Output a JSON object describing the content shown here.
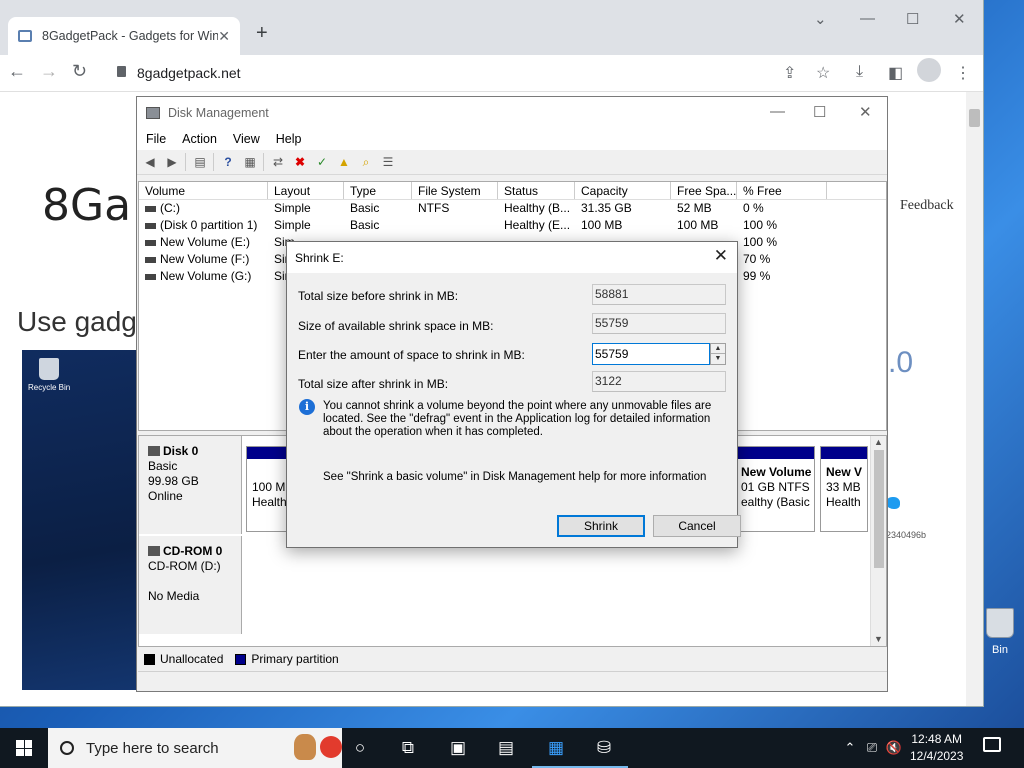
{
  "browser": {
    "tab_title": "8GadgetPack - Gadgets for Win",
    "url": "8gadgetpack.net",
    "new_tab_label": "+",
    "controls": {
      "minimize": "—",
      "maximize": "☐",
      "close": "✕",
      "chevron": "⌄"
    },
    "toolbar_icons": [
      "share-icon",
      "star-icon",
      "download-icon",
      "sidepanel-icon",
      "profile-icon",
      "menu-icon"
    ]
  },
  "page": {
    "title": "8Ga",
    "subtitle": "Use gadg",
    "feedback": "Feedback",
    "version_fragment": ".0",
    "code_fragment": "2340496b",
    "recycle_label": "Recycle Bin"
  },
  "disk_mgmt": {
    "title": "Disk Management",
    "menu": [
      "File",
      "Action",
      "View",
      "Help"
    ],
    "columns": [
      "Volume",
      "Layout",
      "Type",
      "File System",
      "Status",
      "Capacity",
      "Free Spa...",
      "% Free"
    ],
    "rows": [
      [
        "(C:)",
        "Simple",
        "Basic",
        "NTFS",
        "Healthy (B...",
        "31.35 GB",
        "52 MB",
        "0 %"
      ],
      [
        "(Disk 0 partition 1)",
        "Simple",
        "Basic",
        "",
        "Healthy (E...",
        "100 MB",
        "100 MB",
        "100 %"
      ],
      [
        "New Volume (E:)",
        "Sim",
        "",
        "",
        "",
        "",
        "",
        "100 %"
      ],
      [
        "New Volume (F:)",
        "Sir",
        "",
        "",
        "",
        "",
        "",
        "70 %"
      ],
      [
        "New Volume (G:)",
        "Sir",
        "",
        "",
        "",
        "",
        "",
        "99 %"
      ]
    ],
    "disk0": {
      "name": "Disk 0",
      "type": "Basic",
      "size": "99.98 GB",
      "status": "Online"
    },
    "cdrom": {
      "name": "CD-ROM 0",
      "drive": "CD-ROM (D:)",
      "media": "No Media"
    },
    "partitions": [
      {
        "line1": "",
        "line2": "100 MB",
        "line3": "Healthy"
      },
      {
        "line1": "New Volume",
        "line2": "01 GB NTFS",
        "line3": "ealthy (Basic"
      },
      {
        "line1": "New V",
        "line2": "33 MB",
        "line3": "Health"
      }
    ],
    "legend": [
      {
        "label": "Unallocated",
        "color": "#000000"
      },
      {
        "label": "Primary partition",
        "color": "#00008b"
      }
    ]
  },
  "dialog": {
    "title": "Shrink E:",
    "fields": {
      "total_before_label": "Total size before shrink in MB:",
      "total_before_value": "58881",
      "available_label": "Size of available shrink space in MB:",
      "available_value": "55759",
      "enter_label": "Enter the amount of space to shrink in MB:",
      "enter_value": "55759",
      "after_label": "Total size after shrink in MB:",
      "after_value": "3122"
    },
    "info": "You cannot shrink a volume beyond the point where any unmovable files are located. See the \"defrag\" event in the Application log for detailed information about the operation when it has completed.",
    "help": "See \"Shrink a basic volume\" in Disk Management help for more information",
    "buttons": {
      "shrink": "Shrink",
      "cancel": "Cancel"
    }
  },
  "taskbar": {
    "search_placeholder": "Type here to search",
    "time": "12:48 AM",
    "date": "12/4/2023",
    "desktop_icon_label": "Bin"
  },
  "colors": {
    "accent": "#0078d7",
    "partition_bar": "#00008b",
    "taskbar": "#101820"
  }
}
